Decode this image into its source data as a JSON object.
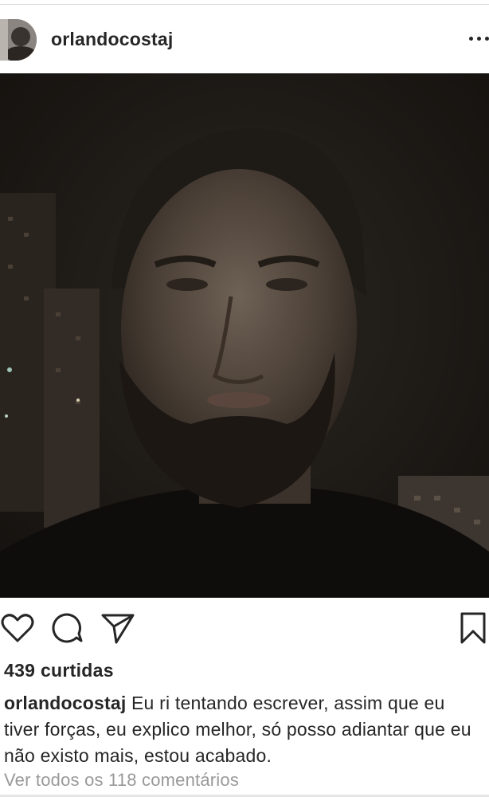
{
  "post": {
    "username": "orlandocostaj",
    "more_icon": "more-dots-icon"
  },
  "actions": {
    "like_icon": "heart-icon",
    "comment_icon": "comment-bubble-icon",
    "share_icon": "paper-plane-icon",
    "save_icon": "bookmark-icon"
  },
  "engagement": {
    "likes_text": "439 curtidas"
  },
  "caption": {
    "username": "orlandocostaj",
    "text": "Eu ri tentando escrever, assim que eu tiver forças, eu explico melhor, só posso adiantar que eu não existo mais, estou acabado."
  },
  "comments": {
    "view_all_text": "Ver todos os 118 comentários"
  },
  "colors": {
    "text": "#262626",
    "muted": "#999999",
    "divider": "#dbdbdb"
  }
}
